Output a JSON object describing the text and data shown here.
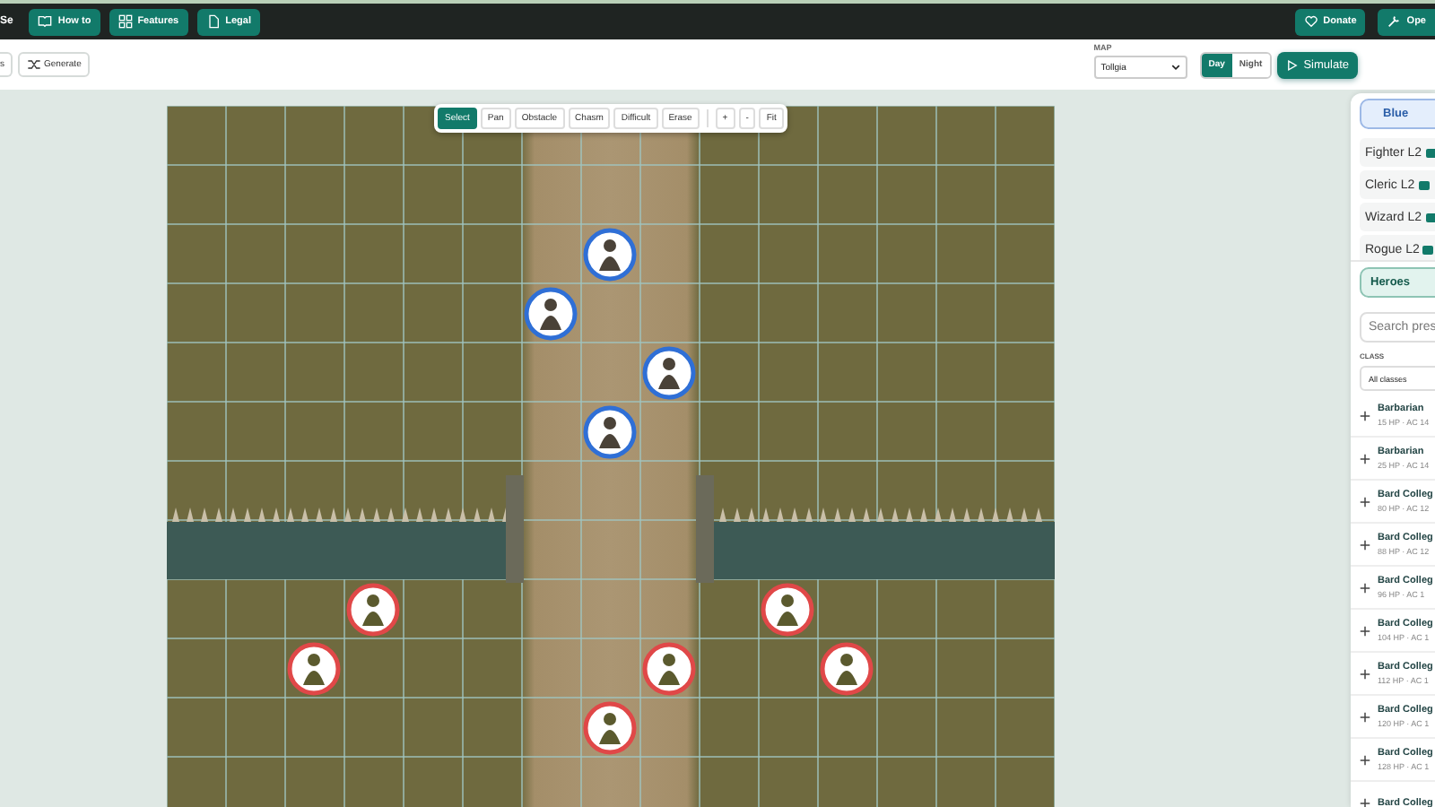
{
  "header": {
    "brand": "Se",
    "nav": [
      {
        "label": "How to",
        "kind": "book"
      },
      {
        "label": "Features",
        "kind": "grid"
      },
      {
        "label": "Legal",
        "kind": "doc"
      }
    ],
    "actions": [
      {
        "label": "Donate",
        "kind": "heart"
      },
      {
        "label": "Ope",
        "kind": "wrench"
      }
    ]
  },
  "toolbar": {
    "buttons": [
      {
        "label": "s",
        "kind": "plain"
      },
      {
        "label": "Generate",
        "kind": "shuffle"
      }
    ],
    "map_label": "MAP",
    "map_select": "Tollgia",
    "time_of_day": [
      {
        "label": "Day",
        "selected": true
      },
      {
        "label": "Night",
        "selected": false
      }
    ],
    "simulate": "Simulate"
  },
  "map_tools": {
    "tools": [
      {
        "label": "Select",
        "selected": true
      },
      {
        "label": "Pan",
        "selected": false
      },
      {
        "label": "Obstacle",
        "selected": false
      },
      {
        "label": "Chasm",
        "selected": false
      },
      {
        "label": "Difficult",
        "selected": false
      },
      {
        "label": "Erase",
        "selected": false
      }
    ],
    "zoom": [
      "+",
      "-",
      "Fit"
    ]
  },
  "tokens": [
    {
      "kind": "hero"
    },
    {
      "kind": "hero"
    },
    {
      "kind": "hero"
    },
    {
      "kind": "hero"
    },
    {
      "kind": "enemy"
    },
    {
      "kind": "enemy"
    },
    {
      "kind": "enemy"
    },
    {
      "kind": "enemy"
    },
    {
      "kind": "enemy"
    },
    {
      "kind": "enemy"
    }
  ],
  "panel": {
    "team_tab": "Blue",
    "party": [
      {
        "name": "Fighter L2"
      },
      {
        "name": "Cleric L2"
      },
      {
        "name": "Wizard L2"
      },
      {
        "name": "Rogue L2"
      }
    ],
    "heroes_tab": "Heroes",
    "search_placeholder": "Search pres",
    "class_label": "CLASS",
    "class_select": "All classes",
    "presets": [
      {
        "name": "Barbarian",
        "stats": "15 HP · AC 14"
      },
      {
        "name": "Barbarian",
        "stats": "25 HP · AC 14"
      },
      {
        "name": "Bard Colleg",
        "stats": "80 HP · AC 12"
      },
      {
        "name": "Bard Colleg",
        "stats": "88 HP · AC 12"
      },
      {
        "name": "Bard Colleg",
        "stats": "96 HP · AC 1"
      },
      {
        "name": "Bard Colleg",
        "stats": "104 HP · AC 1"
      },
      {
        "name": "Bard Colleg",
        "stats": "112 HP · AC 1"
      },
      {
        "name": "Bard Colleg",
        "stats": "120 HP · AC 1"
      },
      {
        "name": "Bard Colleg",
        "stats": "128 HP · AC 1"
      },
      {
        "name": "Bard Colleg"
      }
    ]
  }
}
